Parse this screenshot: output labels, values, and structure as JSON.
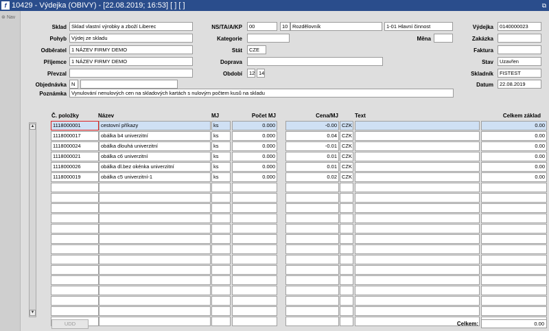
{
  "window": {
    "title": "10429 - Výdejka (OBIVY) - [22.08.2019; 16:53]  [ ]  [ ]",
    "logo": "f",
    "restore_glyph": "⧉"
  },
  "nav": {
    "label": "Nav"
  },
  "header": {
    "sklad_label": "Sklad",
    "sklad_value": "Sklad vlastní výrobky a zboží Liberec",
    "pohyb_label": "Pohyb",
    "pohyb_value": "Výdej ze skladu",
    "odberatel_label": "Odběratel",
    "odberatel_value": "1 NÁZEV FIRMY DEMO",
    "prijemce_label": "Příjemce",
    "prijemce_value": "1 NÁZEV FIRMY DEMO",
    "prevzal_label": "Převzal",
    "prevzal_value": "",
    "objednavka_label": "Objednávka",
    "objednavka_prefix": "N",
    "objednavka_value": "",
    "poznamka_label": "Poznámka",
    "poznamka_value": "Vynulování nenulových cen na skladových kartách s nulovým počtem kusů na skladu",
    "nstakp_label": "NS/TA/A/KP",
    "nstakp_1": "00",
    "nstakp_2": "10",
    "nstakp_3": "Rozdělovník",
    "nstakp_4": "1-01 Hlavní činnost",
    "kategorie_label": "Kategorie",
    "kategorie_value": "",
    "mena_label": "Měna",
    "mena_value": "",
    "stat_label": "Stát",
    "stat_value": "CZE",
    "doprava_label": "Doprava",
    "doprava_value": "",
    "obdobi_label": "Období",
    "obdobi_1": "12",
    "obdobi_2": "14",
    "vydejka_label": "Výdejka",
    "vydejka_value": "0140000023",
    "zakazka_label": "Zakázka",
    "zakazka_value": "",
    "faktura_label": "Faktura",
    "faktura_value": "",
    "stav_label": "Stav",
    "stav_value": "Uzavřen",
    "skladnik_label": "Skladník",
    "skladnik_value": "FISTEST",
    "datum_label": "Datum",
    "datum_value": "22.08.2019"
  },
  "grid": {
    "headers": {
      "cislo": "Č. položky",
      "nazev": "Název",
      "mj": "MJ",
      "pocet": "Počet MJ",
      "cena": "Cena/MJ",
      "text": "Text",
      "celkem": "Celkem základ"
    },
    "rows": [
      {
        "cislo": "1118000001",
        "nazev": "cestovní příkazy",
        "mj": "ks",
        "pocet": "0.000",
        "cena": "-0.00",
        "mena": "CZK",
        "text": "",
        "celkem": "0.00"
      },
      {
        "cislo": "1118000017",
        "nazev": "obálka b4 univerzitní",
        "mj": "ks",
        "pocet": "0.000",
        "cena": "0.04",
        "mena": "CZK",
        "text": "",
        "celkem": "0.00"
      },
      {
        "cislo": "1118000024",
        "nazev": "obálka dlouhá univerzitní",
        "mj": "ks",
        "pocet": "0.000",
        "cena": "-0.01",
        "mena": "CZK",
        "text": "",
        "celkem": "0.00"
      },
      {
        "cislo": "1118000021",
        "nazev": "obálka c6 univerzitní",
        "mj": "ks",
        "pocet": "0.000",
        "cena": "0.01",
        "mena": "CZK",
        "text": "",
        "celkem": "0.00"
      },
      {
        "cislo": "1118000026",
        "nazev": "obálka dl.bez okénka univerzitní",
        "mj": "ks",
        "pocet": "0.000",
        "cena": "0.01",
        "mena": "CZK",
        "text": "",
        "celkem": "0.00"
      },
      {
        "cislo": "1118000019",
        "nazev": "obálka c5 univerzitní-1",
        "mj": "ks",
        "pocet": "0.000",
        "cena": "0.02",
        "mena": "CZK",
        "text": "",
        "celkem": "0.00"
      }
    ],
    "empty_rows": 14
  },
  "footer": {
    "udd_label": "UDD",
    "celkem_label": "Celkem:",
    "celkem_value": "0.00"
  },
  "colors": {
    "titlebar": "#2a4d8c",
    "selected_row": "#cfe0f4",
    "focus_border": "#d22222"
  }
}
